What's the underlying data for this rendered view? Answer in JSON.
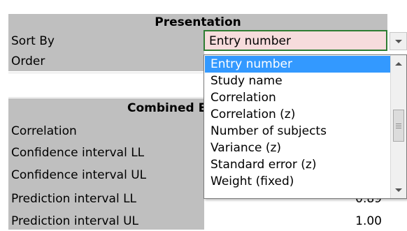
{
  "presentation": {
    "header": "Presentation",
    "sort_by": {
      "label": "Sort By",
      "value": "Entry number"
    },
    "order": {
      "label": "Order"
    }
  },
  "combined": {
    "header_visible": "Combined E",
    "rows": [
      {
        "label": "Correlation"
      },
      {
        "label": "Confidence interval LL"
      },
      {
        "label": "Confidence interval UL"
      },
      {
        "label": "Prediction interval LL",
        "value": "0.89"
      },
      {
        "label": "Prediction interval UL",
        "value": "1.00"
      }
    ]
  },
  "dropdown": {
    "options": [
      "Entry number",
      "Study name",
      "Correlation",
      "Correlation (z)",
      "Number of subjects",
      "Variance (z)",
      "Standard error (z)",
      "Weight (fixed)"
    ],
    "selected_index": 0
  },
  "colors": {
    "band_gray": "#bfbfbf",
    "selected_cell_bg": "#f6dcdc",
    "selected_cell_border": "#2e7d32",
    "highlight": "#3399ff"
  }
}
